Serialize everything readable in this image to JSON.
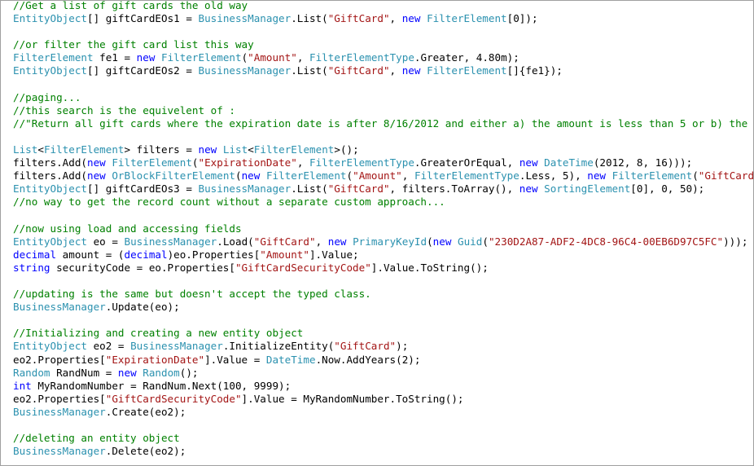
{
  "editor": {
    "colors": {
      "comment": "#008000",
      "keyword": "#0000ff",
      "type": "#2b91af",
      "string": "#a31515",
      "plain": "#000000",
      "background": "#ffffff",
      "border": "#a0a0a0"
    },
    "lines": [
      [
        [
          "c",
          "//Get a list of gift cards the old way"
        ]
      ],
      [
        [
          "t",
          "EntityObject"
        ],
        [
          "p",
          "[] giftCardEOs1 = "
        ],
        [
          "t",
          "BusinessManager"
        ],
        [
          "p",
          ".List("
        ],
        [
          "s",
          "\"GiftCard\""
        ],
        [
          "p",
          ", "
        ],
        [
          "k",
          "new"
        ],
        [
          "p",
          " "
        ],
        [
          "t",
          "FilterElement"
        ],
        [
          "p",
          "[0]);"
        ]
      ],
      [],
      [
        [
          "c",
          "//or filter the gift card list this way"
        ]
      ],
      [
        [
          "t",
          "FilterElement"
        ],
        [
          "p",
          " fe1 = "
        ],
        [
          "k",
          "new"
        ],
        [
          "p",
          " "
        ],
        [
          "t",
          "FilterElement"
        ],
        [
          "p",
          "("
        ],
        [
          "s",
          "\"Amount\""
        ],
        [
          "p",
          ", "
        ],
        [
          "t",
          "FilterElementType"
        ],
        [
          "p",
          ".Greater, 4.80m);"
        ]
      ],
      [
        [
          "t",
          "EntityObject"
        ],
        [
          "p",
          "[] giftCardEOs2 = "
        ],
        [
          "t",
          "BusinessManager"
        ],
        [
          "p",
          ".List("
        ],
        [
          "s",
          "\"GiftCard\""
        ],
        [
          "p",
          ", "
        ],
        [
          "k",
          "new"
        ],
        [
          "p",
          " "
        ],
        [
          "t",
          "FilterElement"
        ],
        [
          "p",
          "[]{fe1});"
        ]
      ],
      [],
      [
        [
          "c",
          "//paging..."
        ]
      ],
      [
        [
          "c",
          "//this search is the equivelent of :"
        ]
      ],
      [
        [
          "c",
          "//\"Return all gift cards where the expiration date is after 8/16/2012 and either a) the amount is less than 5 or b) the security co"
        ]
      ],
      [],
      [
        [
          "t",
          "List"
        ],
        [
          "p",
          "<"
        ],
        [
          "t",
          "FilterElement"
        ],
        [
          "p",
          "> filters = "
        ],
        [
          "k",
          "new"
        ],
        [
          "p",
          " "
        ],
        [
          "t",
          "List"
        ],
        [
          "p",
          "<"
        ],
        [
          "t",
          "FilterElement"
        ],
        [
          "p",
          ">();"
        ]
      ],
      [
        [
          "p",
          "filters.Add("
        ],
        [
          "k",
          "new"
        ],
        [
          "p",
          " "
        ],
        [
          "t",
          "FilterElement"
        ],
        [
          "p",
          "("
        ],
        [
          "s",
          "\"ExpirationDate\""
        ],
        [
          "p",
          ", "
        ],
        [
          "t",
          "FilterElementType"
        ],
        [
          "p",
          ".GreaterOrEqual, "
        ],
        [
          "k",
          "new"
        ],
        [
          "p",
          " "
        ],
        [
          "t",
          "DateTime"
        ],
        [
          "p",
          "(2012, 8, 16)));"
        ]
      ],
      [
        [
          "p",
          "filters.Add("
        ],
        [
          "k",
          "new"
        ],
        [
          "p",
          " "
        ],
        [
          "t",
          "OrBlockFilterElement"
        ],
        [
          "p",
          "("
        ],
        [
          "k",
          "new"
        ],
        [
          "p",
          " "
        ],
        [
          "t",
          "FilterElement"
        ],
        [
          "p",
          "("
        ],
        [
          "s",
          "\"Amount\""
        ],
        [
          "p",
          ", "
        ],
        [
          "t",
          "FilterElementType"
        ],
        [
          "p",
          ".Less, 5), "
        ],
        [
          "k",
          "new"
        ],
        [
          "p",
          " "
        ],
        [
          "t",
          "FilterElement"
        ],
        [
          "p",
          "("
        ],
        [
          "s",
          "\"GiftCardSecurityCod"
        ]
      ],
      [
        [
          "t",
          "EntityObject"
        ],
        [
          "p",
          "[] giftCardEOs3 = "
        ],
        [
          "t",
          "BusinessManager"
        ],
        [
          "p",
          ".List("
        ],
        [
          "s",
          "\"GiftCard\""
        ],
        [
          "p",
          ", filters.ToArray(), "
        ],
        [
          "k",
          "new"
        ],
        [
          "p",
          " "
        ],
        [
          "t",
          "SortingElement"
        ],
        [
          "p",
          "[0], 0, 50);"
        ]
      ],
      [
        [
          "c",
          "//no way to get the record count without a separate custom approach..."
        ]
      ],
      [],
      [
        [
          "c",
          "//now using load and accessing fields"
        ]
      ],
      [
        [
          "t",
          "EntityObject"
        ],
        [
          "p",
          " eo = "
        ],
        [
          "t",
          "BusinessManager"
        ],
        [
          "p",
          ".Load("
        ],
        [
          "s",
          "\"GiftCard\""
        ],
        [
          "p",
          ", "
        ],
        [
          "k",
          "new"
        ],
        [
          "p",
          " "
        ],
        [
          "t",
          "PrimaryKeyId"
        ],
        [
          "p",
          "("
        ],
        [
          "k",
          "new"
        ],
        [
          "p",
          " "
        ],
        [
          "t",
          "Guid"
        ],
        [
          "p",
          "("
        ],
        [
          "s",
          "\"230D2A87-ADF2-4DC8-96C4-00EB6D97C5FC\""
        ],
        [
          "p",
          ")));"
        ]
      ],
      [
        [
          "k",
          "decimal"
        ],
        [
          "p",
          " amount = ("
        ],
        [
          "k",
          "decimal"
        ],
        [
          "p",
          ")eo.Properties["
        ],
        [
          "s",
          "\"Amount\""
        ],
        [
          "p",
          "].Value;"
        ]
      ],
      [
        [
          "k",
          "string"
        ],
        [
          "p",
          " securityCode = eo.Properties["
        ],
        [
          "s",
          "\"GiftCardSecurityCode\""
        ],
        [
          "p",
          "].Value.ToString();"
        ]
      ],
      [],
      [
        [
          "c",
          "//updating is the same but doesn't accept the typed class."
        ]
      ],
      [
        [
          "t",
          "BusinessManager"
        ],
        [
          "p",
          ".Update(eo);"
        ]
      ],
      [],
      [
        [
          "c",
          "//Initializing and creating a new entity object"
        ]
      ],
      [
        [
          "t",
          "EntityObject"
        ],
        [
          "p",
          " eo2 = "
        ],
        [
          "t",
          "BusinessManager"
        ],
        [
          "p",
          ".InitializeEntity("
        ],
        [
          "s",
          "\"GiftCard\""
        ],
        [
          "p",
          ");"
        ]
      ],
      [
        [
          "p",
          "eo2.Properties["
        ],
        [
          "s",
          "\"ExpirationDate\""
        ],
        [
          "p",
          "].Value = "
        ],
        [
          "t",
          "DateTime"
        ],
        [
          "p",
          ".Now.AddYears(2);"
        ]
      ],
      [
        [
          "t",
          "Random"
        ],
        [
          "p",
          " RandNum = "
        ],
        [
          "k",
          "new"
        ],
        [
          "p",
          " "
        ],
        [
          "t",
          "Random"
        ],
        [
          "p",
          "();"
        ]
      ],
      [
        [
          "k",
          "int"
        ],
        [
          "p",
          " MyRandomNumber = RandNum.Next(100, 9999);"
        ]
      ],
      [
        [
          "p",
          "eo2.Properties["
        ],
        [
          "s",
          "\"GiftCardSecurityCode\""
        ],
        [
          "p",
          "].Value = MyRandomNumber.ToString();"
        ]
      ],
      [
        [
          "t",
          "BusinessManager"
        ],
        [
          "p",
          ".Create(eo2);"
        ]
      ],
      [],
      [
        [
          "c",
          "//deleting an entity object"
        ]
      ],
      [
        [
          "t",
          "BusinessManager"
        ],
        [
          "p",
          ".Delete(eo2);"
        ]
      ]
    ]
  }
}
